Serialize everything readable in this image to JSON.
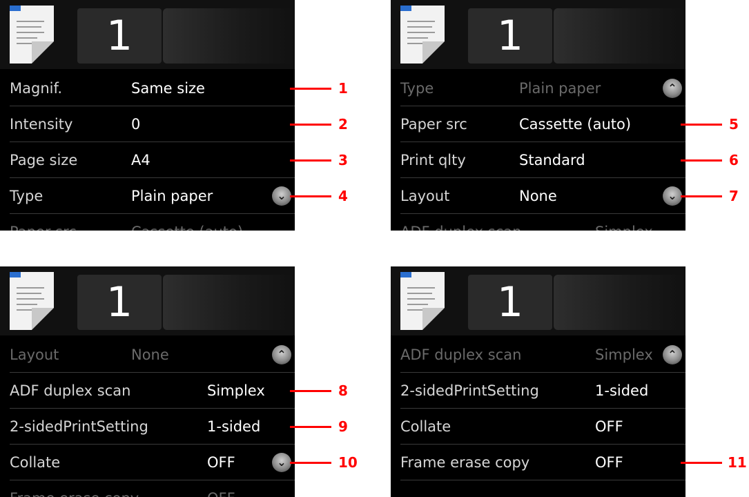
{
  "panel1": {
    "count": "1",
    "rows": [
      {
        "label": "Magnif.",
        "value": "Same size"
      },
      {
        "label": "Intensity",
        "value": "0"
      },
      {
        "label": "Page size",
        "value": "A4"
      },
      {
        "label": "Type",
        "value": "Plain paper"
      },
      {
        "label": "Paper src",
        "value": "Cassette (auto)"
      }
    ],
    "callouts": [
      "1",
      "2",
      "3",
      "4"
    ]
  },
  "panel2": {
    "count": "1",
    "rows": [
      {
        "label": "Type",
        "value": "Plain paper"
      },
      {
        "label": "Paper src",
        "value": "Cassette (auto)"
      },
      {
        "label": "Print qlty",
        "value": "Standard"
      },
      {
        "label": "Layout",
        "value": "None"
      },
      {
        "label": "ADF duplex scan",
        "value": "Simplex"
      }
    ],
    "callouts": [
      "5",
      "6",
      "7"
    ]
  },
  "panel3": {
    "count": "1",
    "rows": [
      {
        "label": "Layout",
        "value": "None"
      },
      {
        "label": "ADF duplex scan",
        "value": "Simplex"
      },
      {
        "label": "2-sidedPrintSetting",
        "value": "1-sided"
      },
      {
        "label": "Collate",
        "value": "OFF"
      },
      {
        "label": "Frame erase copy",
        "value": "OFF"
      }
    ],
    "callouts": [
      "8",
      "9",
      "10"
    ]
  },
  "panel4": {
    "count": "1",
    "rows": [
      {
        "label": "ADF duplex scan",
        "value": "Simplex"
      },
      {
        "label": "2-sidedPrintSetting",
        "value": "1-sided"
      },
      {
        "label": "Collate",
        "value": "OFF"
      },
      {
        "label": "Frame erase copy",
        "value": "OFF"
      }
    ],
    "callouts": [
      "11"
    ]
  },
  "icons": {
    "document": "document-icon",
    "scroll_up": "chevron-up-icon",
    "scroll_down": "chevron-down-icon"
  },
  "colors": {
    "screen_bg": "#000000",
    "callout": "#ff0000"
  }
}
